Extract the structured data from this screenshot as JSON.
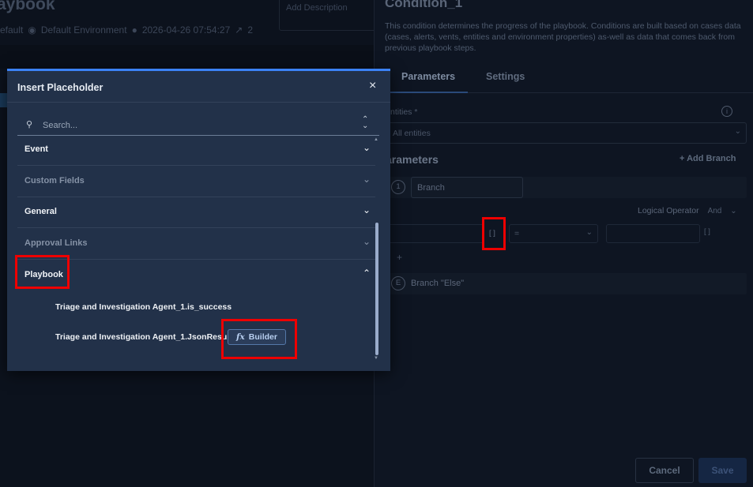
{
  "background": {
    "title": "aybook",
    "environment_prefix": "efault",
    "environment": "Default Environment",
    "timestamp": "2026-04-26 07:54:27",
    "edge_count": "2",
    "description_placeholder": "Add Description"
  },
  "condition_panel": {
    "title": "Condition_1",
    "description": "This condition determines the progress of the playbook. Conditions are built based on cases data (cases, alerts, vents, entities and environment properties) as-well as data that comes back from previous playbook steps.",
    "tabs": [
      "Parameters",
      "Settings"
    ],
    "active_tab": "Parameters",
    "entities_label": "ntities *",
    "entities_value": "All entities",
    "parameters_heading": "arameters",
    "add_branch": "+ Add Branch",
    "branch_number": "1",
    "branch_name": "Branch",
    "logical_operator_label": "Logical Operator",
    "logical_operator_value": "And",
    "placeholder_button": "[ ]",
    "operator_value": "=",
    "value_placeholder_button": "[ ]",
    "add_condition": "+",
    "else_letter": "E",
    "else_label": "Branch \"Else\"",
    "cancel": "Cancel",
    "save": "Save"
  },
  "modal": {
    "title": "Insert Placeholder",
    "close": "×",
    "search_placeholder": "Search...",
    "sections": [
      {
        "label": "Event",
        "expanded": false,
        "dim": false
      },
      {
        "label": "Custom Fields",
        "expanded": false,
        "dim": true
      },
      {
        "label": "General",
        "expanded": false,
        "dim": false
      },
      {
        "label": "Approval Links",
        "expanded": false,
        "dim": true
      },
      {
        "label": "Playbook",
        "expanded": true,
        "dim": false
      }
    ],
    "playbook_items": [
      "Triage and Investigation Agent_1.is_success",
      "Triage and Investigation Agent_1.JsonResult"
    ],
    "builder_label": "Builder"
  },
  "colors": {
    "accent": "#3b82f6",
    "highlight": "#ee0000",
    "modal_bg": "#223149"
  }
}
